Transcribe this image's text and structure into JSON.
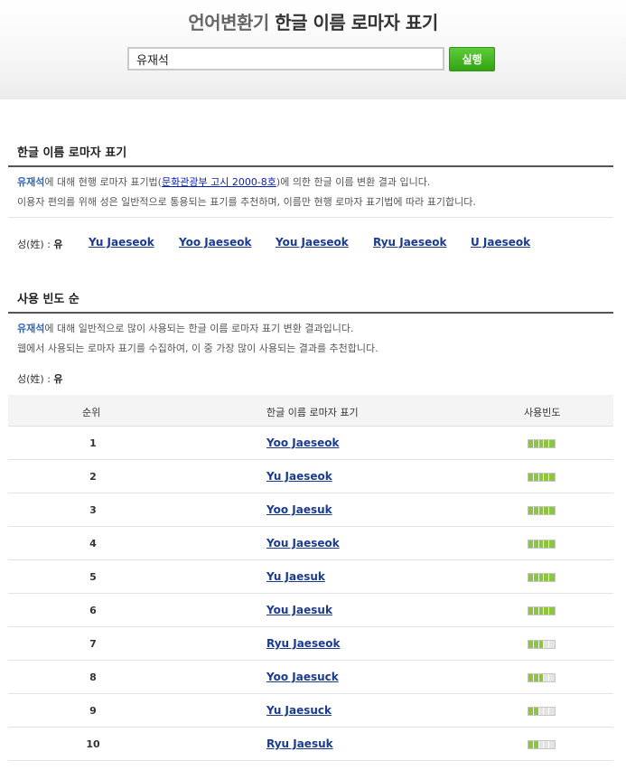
{
  "header": {
    "title_part1": "언어변환기",
    "title_part2": " 한글 이름 로마자 표기",
    "search_value": "유재석",
    "run_label": "실행"
  },
  "section1": {
    "title": "한글 이름 로마자 표기",
    "name": "유재석",
    "line1_a": "에 대해 현행 로마자 표기법(",
    "law_link": "문화관광부 고시 2000-8호",
    "line1_b": ")에 의한 한글 이름 변환 결과 입니다.",
    "line2": "이용자 편의를 위해 성은 일반적으로 통용되는 표기를 추천하며, 이름만 현행 로마자 표기법에 따라 표기합니다.",
    "surname_label": "성(姓) : ",
    "surname": "유",
    "romanizations": [
      "Yu Jaeseok",
      "Yoo Jaeseok",
      "You Jaeseok",
      "Ryu Jaeseok",
      "U Jaeseok"
    ]
  },
  "section2": {
    "title": "사용 빈도 순",
    "name": "유재석",
    "line1": "에 대해 일반적으로 많이 사용되는 한글 이름 로마자 표기 변환 결과입니다.",
    "line2": "웹에서 사용되는 로마자 표기를 수집하여, 이 중 가장 많이 사용되는 결과를 추천합니다.",
    "surname_label": "성(姓) : ",
    "surname": "유",
    "columns": [
      "순위",
      "한글 이름 로마자 표기",
      "사용빈도"
    ],
    "rows": [
      {
        "rank": "1",
        "rom": "Yoo Jaeseok",
        "freq": 5
      },
      {
        "rank": "2",
        "rom": "Yu Jaeseok",
        "freq": 5
      },
      {
        "rank": "3",
        "rom": "Yoo Jaesuk",
        "freq": 5
      },
      {
        "rank": "4",
        "rom": "You Jaeseok",
        "freq": 5
      },
      {
        "rank": "5",
        "rom": "Yu Jaesuk",
        "freq": 5
      },
      {
        "rank": "6",
        "rom": "You Jaesuk",
        "freq": 5
      },
      {
        "rank": "7",
        "rom": "Ryu Jaeseok",
        "freq": 3
      },
      {
        "rank": "8",
        "rom": "Yoo Jaesuck",
        "freq": 3
      },
      {
        "rank": "9",
        "rom": "Yu Jaesuck",
        "freq": 2
      },
      {
        "rank": "10",
        "rom": "Ryu Jaesuk",
        "freq": 2
      }
    ],
    "freq_max": 5,
    "colors": {
      "bar_on": "#8cc63f",
      "bar_off": "#e4e4e4"
    }
  }
}
